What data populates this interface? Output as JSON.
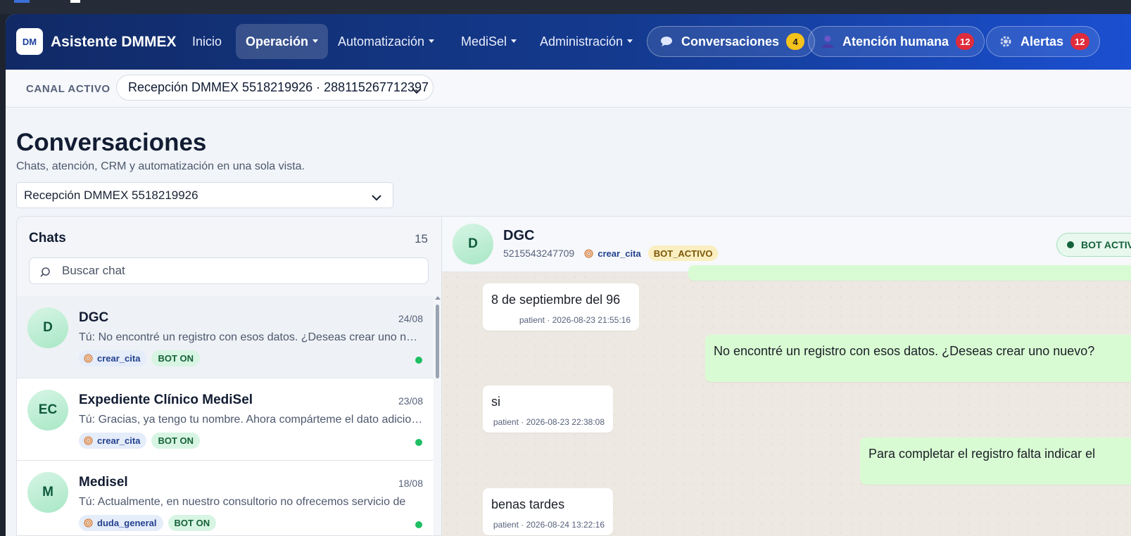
{
  "nav": {
    "logo": "DM",
    "brand": "Asistente DMMEX",
    "items": [
      {
        "label": "Inicio"
      },
      {
        "label": "Operación"
      },
      {
        "label": "Automatización"
      },
      {
        "label": "MediSel"
      },
      {
        "label": "Administración"
      }
    ],
    "pills": [
      {
        "label": "Conversaciones",
        "badge": "4",
        "icon": "chat-bubble-icon"
      },
      {
        "label": "Atención humana",
        "badge": "12",
        "icon": "person-icon"
      },
      {
        "label": "Alertas",
        "badge": "12",
        "icon": "gear-icon"
      }
    ]
  },
  "canal": {
    "label": "CANAL ACTIVO",
    "value": "Recepción DMMEX 5518219926 · 288115267712397"
  },
  "page": {
    "title": "Conversaciones",
    "subtitle": "Chats, atención, CRM y automatización en una sola vista.",
    "inbox_select": "Recepción DMMEX 5518219926"
  },
  "chats": {
    "title": "Chats",
    "count": "15",
    "search_placeholder": "Buscar chat",
    "items": [
      {
        "initials": "D",
        "name": "DGC",
        "date": "24/08",
        "preview": "Tú: No encontré un registro con esos datos. ¿Deseas crear uno nuevo?",
        "intent": "crear_cita",
        "bot": "BOT ON"
      },
      {
        "initials": "EC",
        "name": "Expediente Clínico MediSel",
        "date": "23/08",
        "preview": "Tú: Gracias, ya tengo tu nombre. Ahora compárteme el dato adicional",
        "intent": "crear_cita",
        "bot": "BOT ON"
      },
      {
        "initials": "M",
        "name": "Medisel",
        "date": "18/08",
        "preview": "Tú: Actualmente, en nuestro consultorio no ofrecemos servicio de",
        "intent": "duda_general",
        "bot": "BOT ON"
      }
    ]
  },
  "conversation": {
    "initials": "D",
    "name": "DGC",
    "phone": "5215543247709",
    "intent": "crear_cita",
    "status_tag": "BOT_ACTIVO",
    "bot_pill": "BOT ACTIVO",
    "messages": [
      {
        "text": "8 de septiembre del 96",
        "meta": "patient · 2026-08-23 21:55:16"
      },
      {
        "text": "No encontré un registro con esos datos. ¿Deseas crear uno nuevo?"
      },
      {
        "text": "si",
        "meta": "patient · 2026-08-23 22:38:08"
      },
      {
        "text": "Para completar el registro falta indicar el"
      },
      {
        "text": "benas tardes",
        "meta": "patient · 2026-08-24 13:22:16"
      }
    ]
  },
  "colors": {
    "nav_start": "#112a66",
    "nav_end": "#1a4fd0",
    "badge_yellow": "#f6c21c",
    "badge_red": "#df2c3c",
    "online_green": "#1fbf63",
    "outgoing_bubble": "#d9fbd3"
  }
}
